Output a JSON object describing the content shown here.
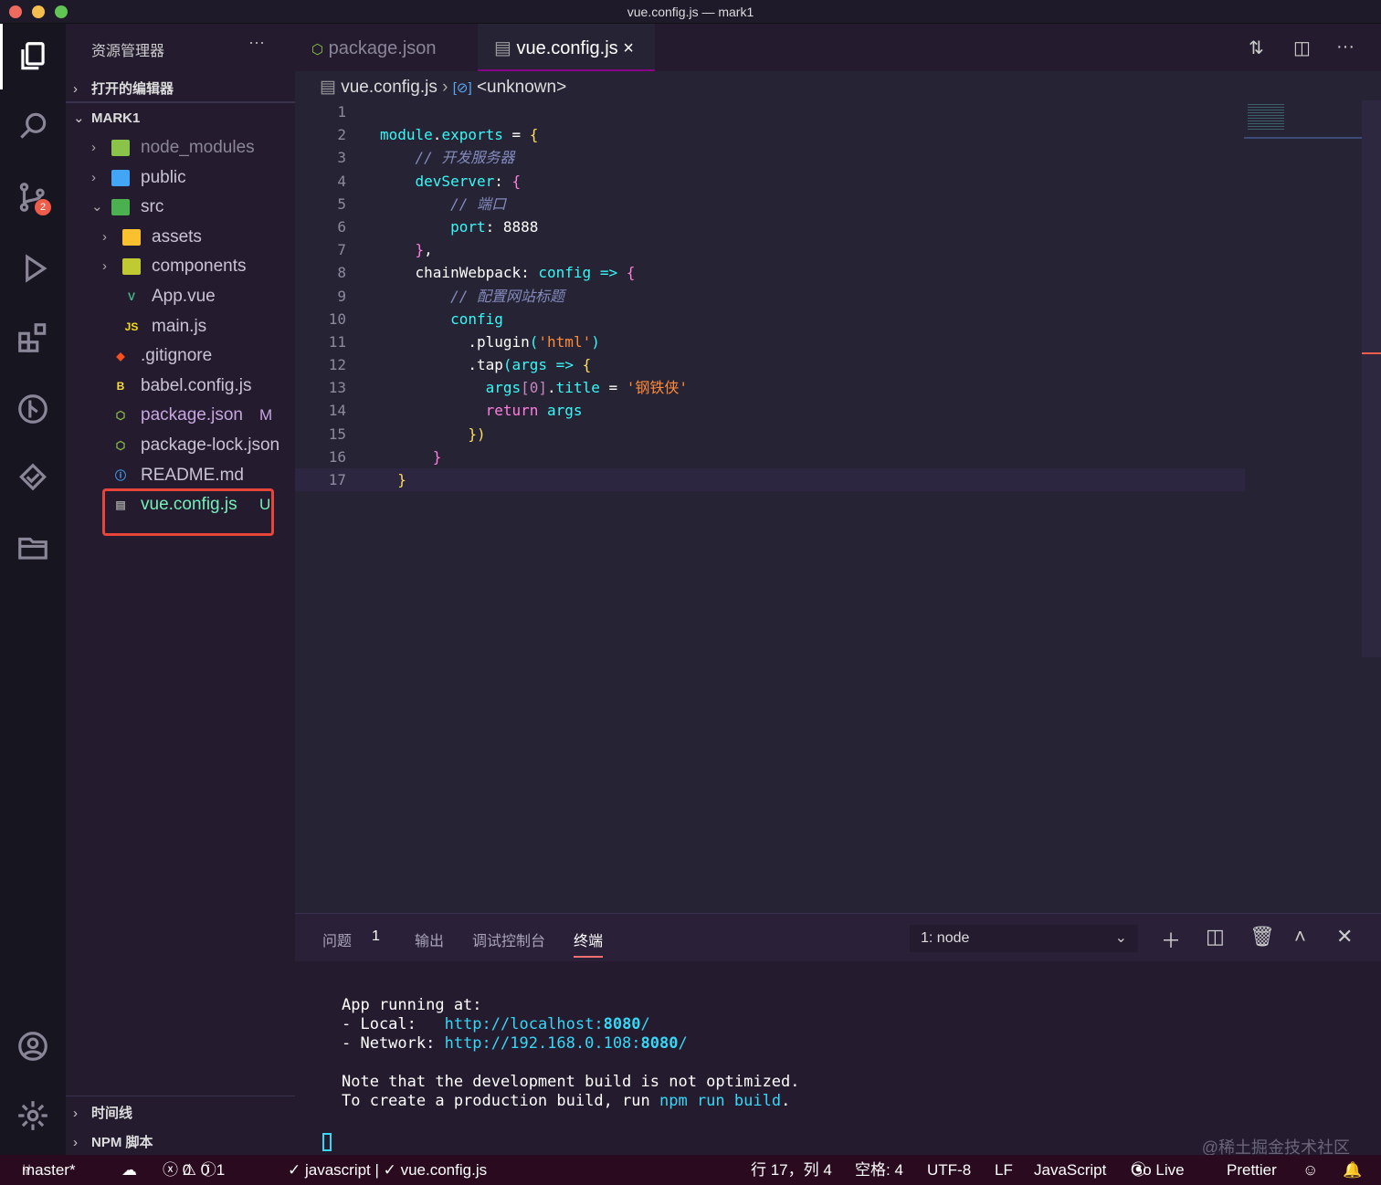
{
  "window": {
    "title": "vue.config.js — mark1"
  },
  "activity": {
    "scm_badge": "2"
  },
  "sidebar": {
    "header": "资源管理器",
    "more": "···",
    "open_editors": "打开的编辑器",
    "project": "MARK1",
    "items": [
      {
        "name": "node_modules",
        "icon": "folder-node-icon",
        "color": "#8bc34a",
        "chev": "›",
        "depth": 0,
        "dim": true
      },
      {
        "name": "public",
        "icon": "folder-public-icon",
        "color": "#42a5f5",
        "chev": "›",
        "depth": 0
      },
      {
        "name": "src",
        "icon": "folder-src-icon",
        "color": "#4caf50",
        "chev": "⌄",
        "depth": 0
      },
      {
        "name": "assets",
        "icon": "folder-assets-icon",
        "color": "#fbc02d",
        "chev": "›",
        "depth": 1
      },
      {
        "name": "components",
        "icon": "folder-components-icon",
        "color": "#c0ca33",
        "chev": "›",
        "depth": 1
      },
      {
        "name": "App.vue",
        "icon": "vue-icon",
        "color": "#41b883",
        "depth": 1
      },
      {
        "name": "main.js",
        "icon": "js-icon",
        "color": "#f5de19",
        "depth": 1
      },
      {
        "name": ".gitignore",
        "icon": "git-icon",
        "color": "#f4511e",
        "depth": 0
      },
      {
        "name": "babel.config.js",
        "icon": "babel-icon",
        "color": "#f9dc3e",
        "depth": 0
      },
      {
        "name": "package.json",
        "icon": "nodejs-icon",
        "color": "#8bc34a",
        "depth": 0,
        "status": "M",
        "text_color": "#c7a6e0"
      },
      {
        "name": "package-lock.json",
        "icon": "nodejs-icon",
        "color": "#8bc34a",
        "depth": 0
      },
      {
        "name": "README.md",
        "icon": "info-icon",
        "color": "#42a5f5",
        "depth": 0
      },
      {
        "name": "vue.config.js",
        "icon": "vue-config-icon",
        "color": "#9e9e9e",
        "depth": 0,
        "status": "U",
        "text_color": "#72f1b8"
      }
    ],
    "timeline": "时间线",
    "npm": "NPM 脚本"
  },
  "tabs": [
    {
      "label": "package.json"
    },
    {
      "label": "vue.config.js",
      "close": "×"
    }
  ],
  "breadcrumb": {
    "file": "vue.config.js",
    "symbol": "<unknown>"
  },
  "code": [
    [],
    [
      [
        "module",
        "k-prop"
      ],
      [
        ".",
        "k-wh"
      ],
      [
        "exports",
        "k-prop"
      ],
      [
        " = ",
        "k-wh"
      ],
      [
        "{",
        "k-yel"
      ]
    ],
    [
      [
        "    // 开发服务器",
        "k-com"
      ]
    ],
    [
      [
        "    devServer",
        "k-prop"
      ],
      [
        ": ",
        "k-wh"
      ],
      [
        "{",
        "k-pink"
      ]
    ],
    [
      [
        "        // 端口",
        "k-com"
      ]
    ],
    [
      [
        "        port",
        "k-prop"
      ],
      [
        ": ",
        "k-wh"
      ],
      [
        "8888",
        "k-wh"
      ]
    ],
    [
      [
        "    }",
        "k-pink"
      ],
      [
        ",",
        "k-wh"
      ]
    ],
    [
      [
        "    chainWebpack",
        "k-fn"
      ],
      [
        ": ",
        "k-wh"
      ],
      [
        "config",
        "k-prop"
      ],
      [
        " => ",
        "k-prop"
      ],
      [
        "{",
        "k-pink"
      ]
    ],
    [
      [
        "        // 配置网站标题",
        "k-com"
      ]
    ],
    [
      [
        "        config",
        "k-prop"
      ]
    ],
    [
      [
        "          .",
        "k-wh"
      ],
      [
        "plugin",
        "k-fn"
      ],
      [
        "(",
        "k-prop"
      ],
      [
        "'html'",
        "k-str"
      ],
      [
        ")",
        "k-prop"
      ]
    ],
    [
      [
        "          .",
        "k-wh"
      ],
      [
        "tap",
        "k-fn"
      ],
      [
        "(",
        "k-prop"
      ],
      [
        "args",
        "k-prop"
      ],
      [
        " => ",
        "k-prop"
      ],
      [
        "{",
        "k-yel"
      ]
    ],
    [
      [
        "            args",
        "k-prop"
      ],
      [
        "[0]",
        "k-br"
      ],
      [
        ".",
        "k-wh"
      ],
      [
        "title",
        "k-prop"
      ],
      [
        " = ",
        "k-wh"
      ],
      [
        "'钢铁侠'",
        "k-str"
      ]
    ],
    [
      [
        "            return ",
        "k-pink"
      ],
      [
        "args",
        "k-prop"
      ]
    ],
    [
      [
        "          })",
        "k-yel"
      ]
    ],
    [
      [
        "      }",
        "k-pink"
      ]
    ],
    [
      [
        "  }",
        "k-yel"
      ]
    ]
  ],
  "panel": {
    "tabs": [
      "问题",
      "输出",
      "调试控制台",
      "终端"
    ],
    "problem_count": "1",
    "terminal_select": "1: node",
    "terminal": {
      "l1": "App running at:",
      "l2a": "- Local:   ",
      "l2b": "http://localhost:",
      "l2c": "8080",
      "l2d": "/",
      "l3a": "- Network: ",
      "l3b": "http://192.168.0.108:",
      "l3c": "8080",
      "l3d": "/",
      "l4": "Note that the development build is not optimized.",
      "l5a": "To create a production build, run ",
      "l5b": "npm run build",
      "l5c": "."
    },
    "watermark": "@稀土掘金技术社区"
  },
  "status": {
    "branch": "master*",
    "errors": "0",
    "warnings": "0",
    "info": "1",
    "lint": "✓ javascript | ✓ vue.config.js",
    "position": "行 17，列 4",
    "spaces": "空格: 4",
    "encoding": "UTF-8",
    "eol": "LF",
    "language": "JavaScript",
    "golive": "Go Live",
    "prettier": "Prettier"
  }
}
